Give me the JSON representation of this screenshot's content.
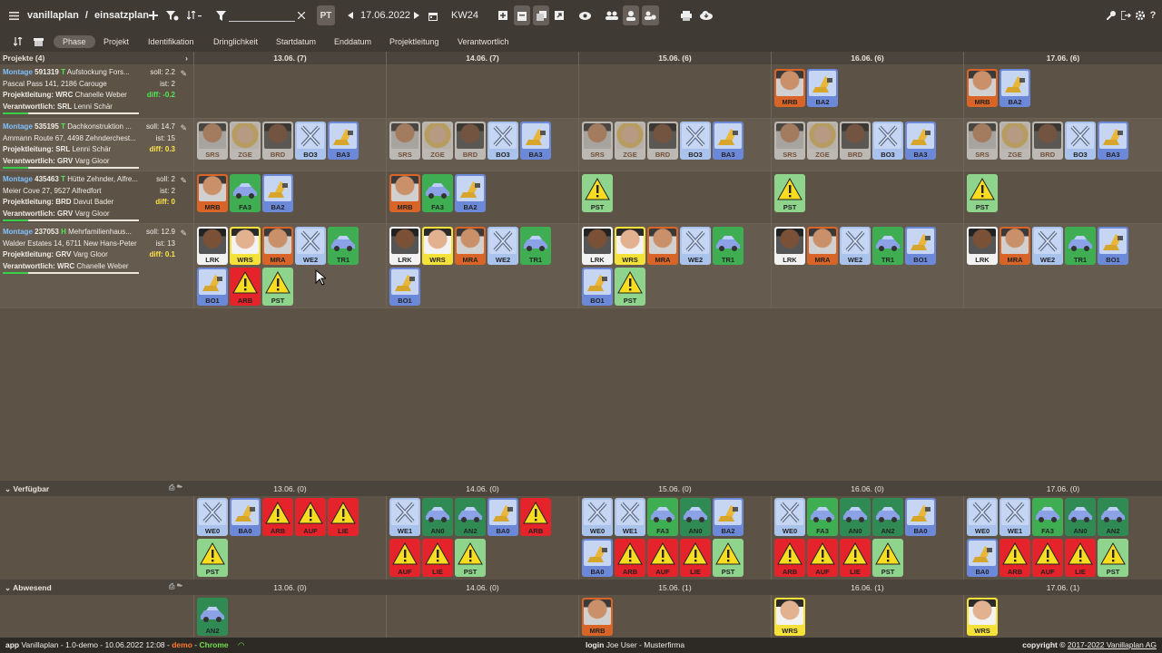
{
  "topbar": {
    "menu_icon": "hamburger-icon",
    "crumb_app": "vanillaplan",
    "crumb_sep": "/",
    "crumb_page": "einsatzplan",
    "pt_label": "PT",
    "date": "17.06.2022",
    "week": "KW24"
  },
  "tabs": [
    "Phase",
    "Projekt",
    "Identifikation",
    "Dringlichkeit",
    "Startdatum",
    "Enddatum",
    "Projektleitung",
    "Verantwortlich"
  ],
  "projects_header": "Projekte (4)",
  "day_headers": [
    "13.06. (7)",
    "14.06. (7)",
    "15.06. (6)",
    "16.06. (6)",
    "17.06. (6)"
  ],
  "projects": [
    {
      "type": "Montage",
      "id": "591319",
      "code": "T",
      "name": "Aufstockung Fors...",
      "address": "Pascal Pass 141, 2186 Carouge",
      "soll": "soll: 2.2",
      "ist": "ist: 2",
      "pl_label": "Projektleitung:",
      "pl": "WRC",
      "pl_name": "Chanelle Weber",
      "diff": "diff: -0.2",
      "vw_label": "Verantwortlich:",
      "vw": "SRL",
      "vw_name": "Lenni Schär"
    },
    {
      "type": "Montage",
      "id": "535195",
      "code": "T",
      "name": "Dachkonstruktion ...",
      "address": "Ammann Route 67, 4498 Zehnderchest...",
      "soll": "soll: 14.7",
      "ist": "ist: 15",
      "pl_label": "Projektleitung:",
      "pl": "SRL",
      "pl_name": "Lenni Schär",
      "diff": "diff: 0.3",
      "vw_label": "Verantwortlich:",
      "vw": "GRV",
      "vw_name": "Varg Gloor"
    },
    {
      "type": "Montage",
      "id": "435463",
      "code": "T",
      "name": "Hütte Zehnder, Alfre...",
      "address": "Meier Cove 27, 9527 Alfredfort",
      "soll": "soll: 2",
      "ist": "ist: 2",
      "pl_label": "Projektleitung:",
      "pl": "BRD",
      "pl_name": "Davut Bader",
      "diff": "diff: 0",
      "vw_label": "Verantwortlich:",
      "vw": "GRV",
      "vw_name": "Varg Gloor"
    },
    {
      "type": "Montage",
      "id": "237053",
      "code": "H",
      "name": "Mehrfamilienhaus...",
      "address": "Walder Estates 14, 6711 New Hans-Peter",
      "soll": "soll: 12.9",
      "ist": "ist: 13",
      "pl_label": "Projektleitung:",
      "pl": "GRV",
      "pl_name": "Varg Gloor",
      "diff": "diff: 0.1",
      "vw_label": "Verantwortlich:",
      "vw": "WRC",
      "vw_name": "Chanelle Weber"
    }
  ],
  "available": {
    "title": "Verfügbar",
    "days": [
      "13.06. (0)",
      "14.06. (0)",
      "15.06. (0)",
      "16.06. (0)",
      "17.06. (0)"
    ]
  },
  "absent": {
    "title": "Abwesend",
    "days": [
      "13.06. (0)",
      "14.06. (0)",
      "15.06. (1)",
      "16.06. (1)",
      "17.06. (1)"
    ]
  },
  "tile_labels": {
    "r0": [
      [],
      [],
      [],
      [
        "MRB",
        "BA2"
      ],
      [
        "MRB",
        "BA2"
      ]
    ],
    "r1": [
      [
        "SRS",
        "ZGE",
        "BRD",
        "BO3",
        "BA3"
      ],
      [
        "SRS",
        "ZGE",
        "BRD",
        "BO3",
        "BA3"
      ],
      [
        "SRS",
        "ZGE",
        "BRD",
        "BO3",
        "BA3"
      ],
      [
        "SRS",
        "ZGE",
        "BRD",
        "BO3",
        "BA3"
      ],
      [
        "SRS",
        "ZGE",
        "BRD",
        "BO3",
        "BA3"
      ]
    ],
    "r2": [
      [
        "MRB",
        "FA3",
        "BA2"
      ],
      [
        "MRB",
        "FA3",
        "BA2"
      ],
      [
        "PST"
      ],
      [
        "PST"
      ],
      [
        "PST"
      ]
    ],
    "r3": [
      [
        "LRK",
        "WRS",
        "MRA",
        "WE2",
        "TR1",
        "BO1",
        "ARB",
        "PST"
      ],
      [
        "LRK",
        "WRS",
        "MRA",
        "WE2",
        "TR1",
        "BO1"
      ],
      [
        "LRK",
        "WRS",
        "MRA",
        "WE2",
        "TR1",
        "BO1",
        "PST"
      ],
      [
        "LRK",
        "MRA",
        "WE2",
        "TR1",
        "BO1"
      ],
      [
        "LRK",
        "MRA",
        "WE2",
        "TR1",
        "BO1"
      ]
    ],
    "avail": [
      [
        "WE0",
        "BA0",
        "ARB",
        "AUF",
        "LIE",
        "PST"
      ],
      [
        "WE1",
        "AN0",
        "AN2",
        "BA0",
        "ARB",
        "AUF",
        "LIE",
        "PST"
      ],
      [
        "WE0",
        "WE1",
        "FA3",
        "AN0",
        "BA2",
        "BA0",
        "ARB",
        "AUF",
        "LIE",
        "PST"
      ],
      [
        "WE0",
        "FA3",
        "AN0",
        "AN2",
        "BA0",
        "ARB",
        "AUF",
        "LIE",
        "PST"
      ],
      [
        "WE0",
        "WE1",
        "FA3",
        "AN0",
        "AN2",
        "BA0",
        "ARB",
        "AUF",
        "LIE",
        "PST"
      ]
    ],
    "absent": [
      [
        "AN2"
      ],
      [],
      [
        "MRB"
      ],
      [
        "WRS"
      ],
      [
        "WRS"
      ]
    ]
  },
  "status": {
    "app_label": "app",
    "app_text": "Vanillaplan - 1.0-demo - 10.06.2022 12:08 -",
    "env": "demo",
    "dash": "-",
    "browser": "Chrome",
    "login_label": "login",
    "login_text": "Joe User - Musterfirma",
    "copyright_label": "copyright ©",
    "copyright_text": "2017-2022 Vanillaplan AG"
  },
  "colors": {
    "bg": "#5c5246",
    "bar": "#3f3a33",
    "accent_blue": "#7fc1ff",
    "diff_green": "#57e657",
    "diff_yellow": "#ffe54a"
  }
}
